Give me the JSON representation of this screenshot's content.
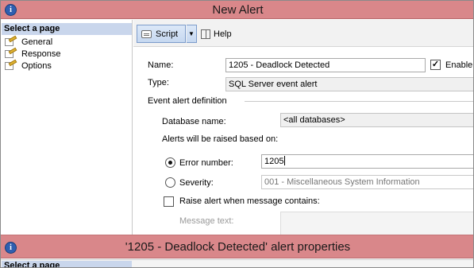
{
  "dialog": {
    "title": "New Alert",
    "title_icon": "info-circle-icon"
  },
  "left_pane": {
    "header": "Select a page",
    "pages": [
      {
        "label": "General",
        "icon": "page-wand-icon"
      },
      {
        "label": "Response",
        "icon": "page-wand-icon"
      },
      {
        "label": "Options",
        "icon": "page-wand-icon"
      }
    ]
  },
  "toolbar": {
    "script_label": "Script",
    "script_dropdown_glyph": "▼",
    "help_label": "Help"
  },
  "form": {
    "name_label": "Name:",
    "name_value": "1205 - Deadlock Detected",
    "enable_label": "Enable",
    "enable_checked": true,
    "enable_check_glyph": "✓",
    "type_label": "Type:",
    "type_value": "SQL Server event alert",
    "event_section_label": "Event alert definition",
    "database_label": "Database name:",
    "database_value": "<all databases>",
    "raised_based_on_label": "Alerts will be raised based on:",
    "error_number_label": "Error number:",
    "error_number_value": "1205",
    "error_number_selected": true,
    "severity_label": "Severity:",
    "severity_value": "001 - Miscellaneous System Information",
    "severity_selected": false,
    "raise_message_label": "Raise alert when message contains:",
    "raise_message_checked": false,
    "message_text_label": "Message text:"
  },
  "second_window": {
    "title": "'1205 - Deadlock Detected' alert properties",
    "title_icon": "info-circle-icon",
    "left_header": "Select a page"
  },
  "colors": {
    "titlebar": "#d9878a",
    "select_page_bg": "#c9d6ec",
    "script_button_bg": "#c6d8f0"
  }
}
